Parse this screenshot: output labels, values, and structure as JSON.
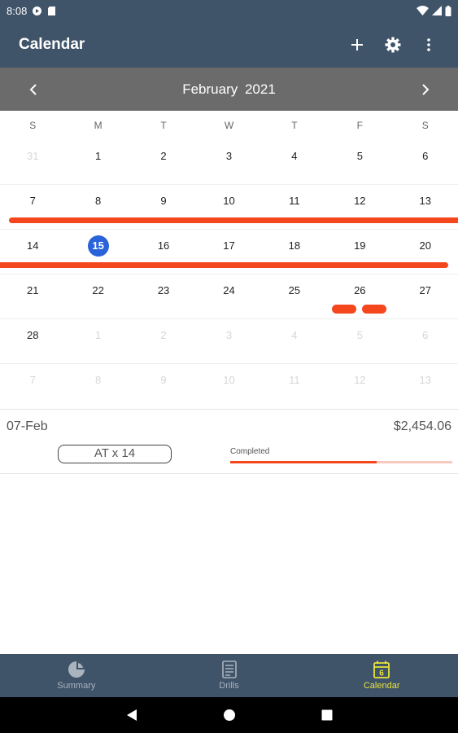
{
  "status_bar": {
    "time": "8:08"
  },
  "app_bar": {
    "title": "Calendar"
  },
  "month_header": {
    "label": "February  2021"
  },
  "weekdays": [
    "S",
    "M",
    "T",
    "W",
    "T",
    "F",
    "S"
  ],
  "weeks": [
    [
      "31",
      "1",
      "2",
      "3",
      "4",
      "5",
      "6"
    ],
    [
      "7",
      "8",
      "9",
      "10",
      "11",
      "12",
      "13"
    ],
    [
      "14",
      "15",
      "16",
      "17",
      "18",
      "19",
      "20"
    ],
    [
      "21",
      "22",
      "23",
      "24",
      "25",
      "26",
      "27"
    ],
    [
      "28",
      "1",
      "2",
      "3",
      "4",
      "5",
      "6"
    ],
    [
      "7",
      "8",
      "9",
      "10",
      "11",
      "12",
      "13"
    ]
  ],
  "selected_day": "15",
  "detail": {
    "date": "07-Feb",
    "amount": "$2,454.06",
    "tag": "AT x 14",
    "progress_label": "Completed",
    "progress_fraction": 0.66
  },
  "bottom_nav": {
    "items": [
      {
        "label": "Summary"
      },
      {
        "label": "Drills"
      },
      {
        "label": "Calendar",
        "icon_text": "6"
      }
    ]
  },
  "colors": {
    "bar": "#3f5369",
    "month_header": "#6b6b6b",
    "event": "#f4471e",
    "today": "#2962d9",
    "active_nav": "#e9e43b"
  }
}
